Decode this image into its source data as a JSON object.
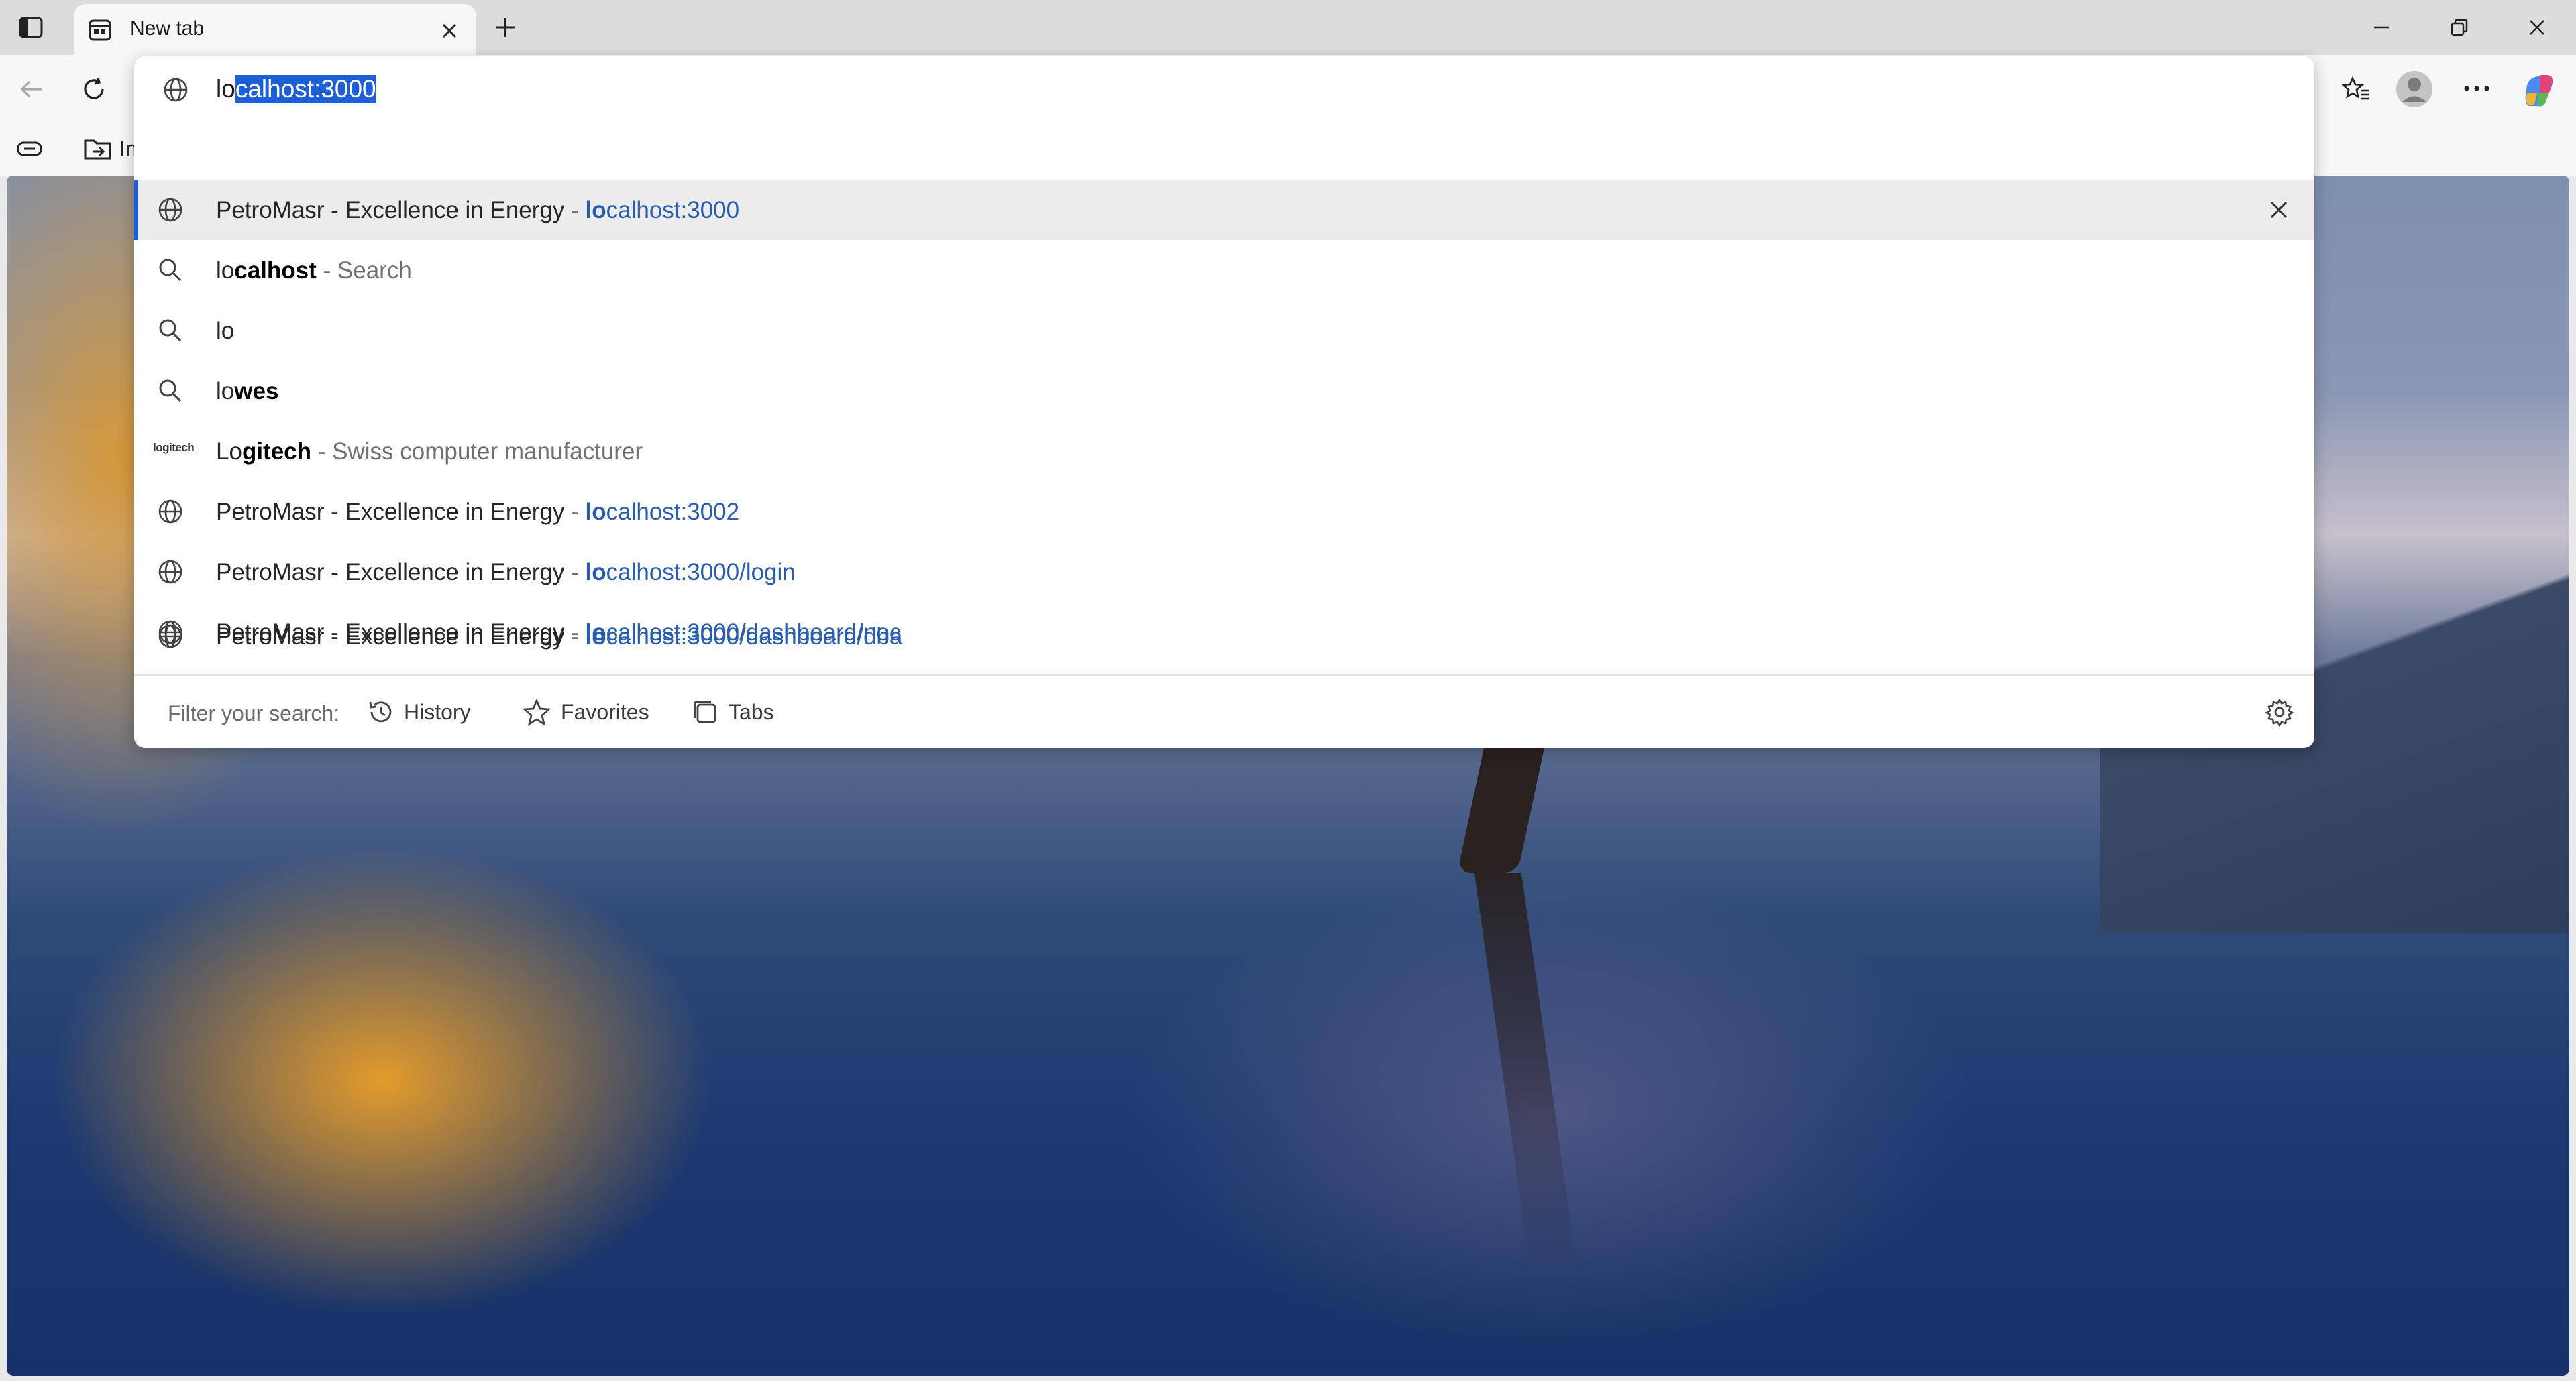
{
  "tab": {
    "title": "New tab"
  },
  "omnibox": {
    "typed": "lo",
    "completion": "calhost:3000"
  },
  "favorites_bar": {
    "folder_label": "In"
  },
  "suggestions": [
    {
      "icon": "globe-icon",
      "title": "PetroMasr - Excellence in Energy",
      "sep": " - ",
      "url_bold": "lo",
      "url_rest": "calhost:3000"
    },
    {
      "icon": "search-icon",
      "prefix": "lo",
      "bold": "calhost",
      "suffix": " - Search"
    },
    {
      "icon": "search-icon",
      "prefix": "lo",
      "bold": ""
    },
    {
      "icon": "search-icon",
      "prefix": "lo",
      "bold": "wes"
    },
    {
      "icon": "logitech-logo",
      "logo_text": "logitech",
      "bold_prefix": "Lo",
      "bold": "gitech",
      "suffix": " - Swiss computer manufacturer"
    },
    {
      "icon": "globe-icon",
      "title": "PetroMasr - Excellence in Energy",
      "sep": " - ",
      "url_bold": "lo",
      "url_rest": "calhost:3002"
    },
    {
      "icon": "globe-icon",
      "title": "PetroMasr - Excellence in Energy",
      "sep": " - ",
      "url_bold": "lo",
      "url_rest": "calhost:3000/login"
    },
    {
      "icon": "globe-icon",
      "title": "PetroMasr - Excellence in Energy",
      "sep": " - ",
      "url_bold": "lo",
      "url_rest": "calhost:3000/dashboard/noc"
    },
    {
      "icon": "globe-icon",
      "title": "PetroMasr - Excellence in Energy",
      "sep": " - ",
      "url_bold": "lo",
      "url_rest": "calhost:3000/dashboard/dba"
    }
  ],
  "filter": {
    "label": "Filter your search:",
    "history": "History",
    "favorites": "Favorites",
    "tabs": "Tabs"
  },
  "colors": {
    "accent": "#1c5fd6",
    "url": "#2a5db0"
  }
}
